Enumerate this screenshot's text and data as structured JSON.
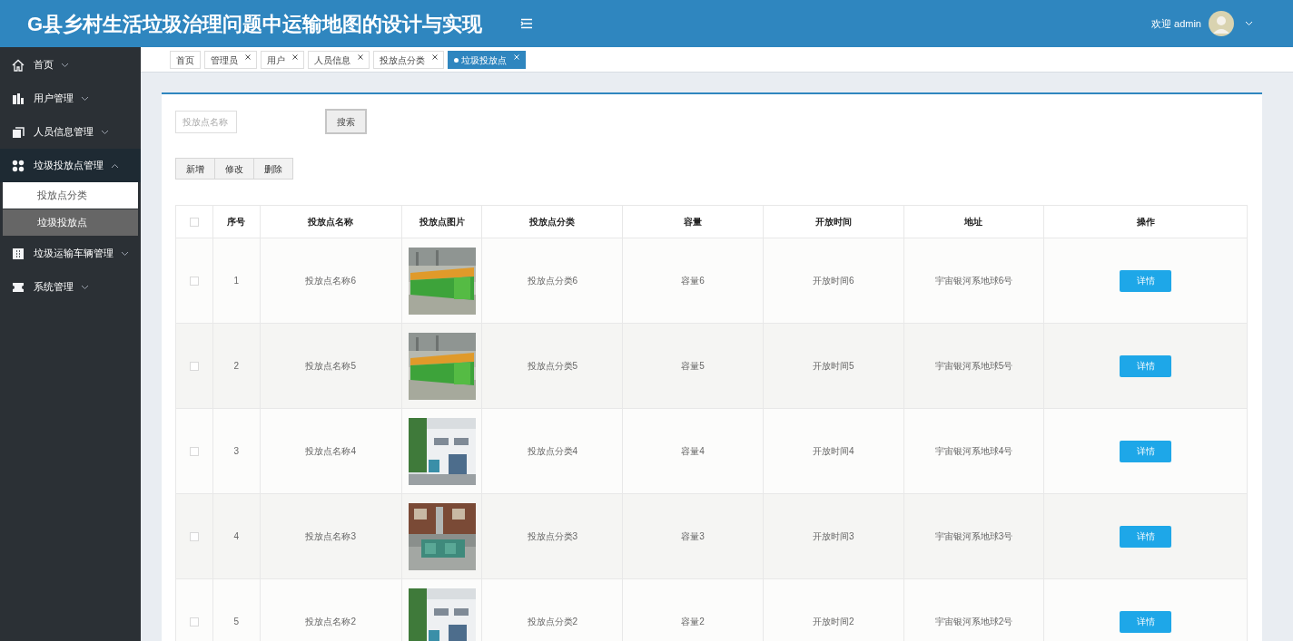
{
  "header": {
    "title": "G县乡村生活垃圾治理问题中运输地图的设计与实现",
    "welcome": "欢迎 admin"
  },
  "sidebar": {
    "items": [
      {
        "label": "首页",
        "expanded": false
      },
      {
        "label": "用户管理",
        "expanded": false
      },
      {
        "label": "人员信息管理",
        "expanded": false
      },
      {
        "label": "垃圾投放点管理",
        "expanded": true,
        "children": [
          {
            "label": "投放点分类",
            "selected": false
          },
          {
            "label": "垃圾投放点",
            "selected": true
          }
        ]
      },
      {
        "label": "垃圾运输车辆管理",
        "expanded": false
      },
      {
        "label": "系统管理",
        "expanded": false
      }
    ]
  },
  "tabs": [
    {
      "label": "首页",
      "closable": false,
      "selected": false
    },
    {
      "label": "管理员",
      "closable": true,
      "selected": false
    },
    {
      "label": "用户",
      "closable": true,
      "selected": false
    },
    {
      "label": "人员信息",
      "closable": true,
      "selected": false
    },
    {
      "label": "投放点分类",
      "closable": true,
      "selected": false
    },
    {
      "label": "垃圾投放点",
      "closable": true,
      "selected": true
    }
  ],
  "search": {
    "placeholder": "投放点名称",
    "button": "搜索"
  },
  "actions": [
    "新增",
    "修改",
    "删除"
  ],
  "table": {
    "all_checked": false,
    "columns": [
      "序号",
      "投放点名称",
      "投放点图片",
      "投放点分类",
      "容量",
      "开放时间",
      "地址",
      "操作"
    ],
    "rows": [
      {
        "checked": false,
        "index": "1",
        "name": "投放点名称6",
        "category": "投放点分类6",
        "capacity": "容量6",
        "time": "开放时间6",
        "address": "宇宙银河系地球6号",
        "action": "详情"
      },
      {
        "checked": false,
        "index": "2",
        "name": "投放点名称5",
        "category": "投放点分类5",
        "capacity": "容量5",
        "time": "开放时间5",
        "address": "宇宙银河系地球5号",
        "action": "详情"
      },
      {
        "checked": false,
        "index": "3",
        "name": "投放点名称4",
        "category": "投放点分类4",
        "capacity": "容量4",
        "time": "开放时间4",
        "address": "宇宙银河系地球4号",
        "action": "详情"
      },
      {
        "checked": false,
        "index": "4",
        "name": "投放点名称3",
        "category": "投放点分类3",
        "capacity": "容量3",
        "time": "开放时间3",
        "address": "宇宙银河系地球3号",
        "action": "详情"
      },
      {
        "checked": false,
        "index": "5",
        "name": "投放点名称2",
        "category": "投放点分类2",
        "capacity": "容量2",
        "time": "开放时间2",
        "address": "宇宙银河系地球2号",
        "action": "详情"
      }
    ]
  }
}
